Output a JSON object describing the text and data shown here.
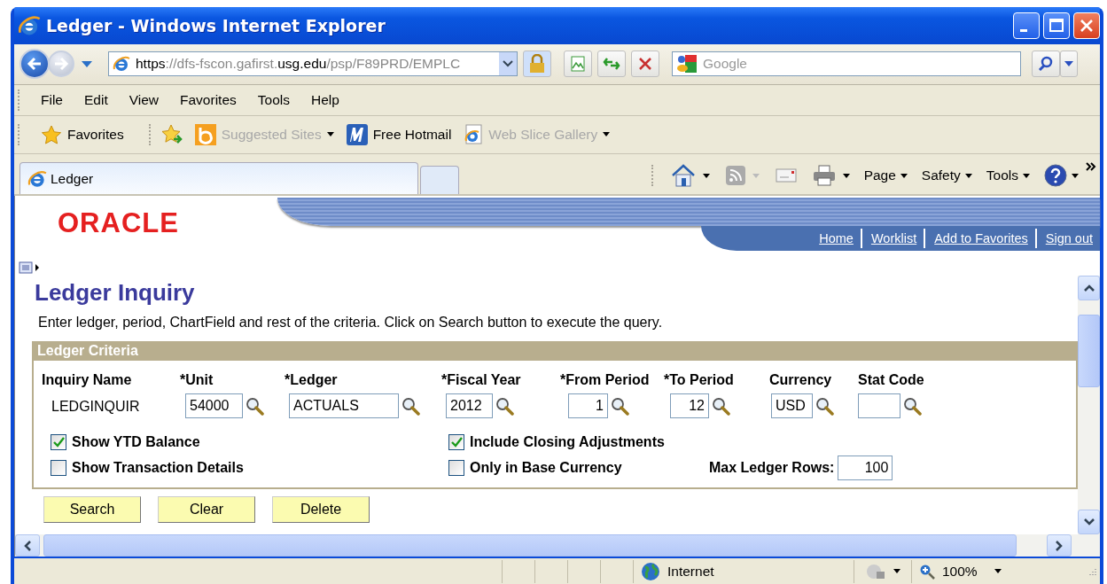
{
  "window": {
    "title": "Ledger - Windows Internet Explorer"
  },
  "address_bar": {
    "url_parts": [
      {
        "text": "https",
        "strong": true
      },
      {
        "text": "://dfs-fscon.gafirst.",
        "strong": false
      },
      {
        "text": "usg.edu",
        "strong": true
      },
      {
        "text": "/psp/F89PRD/EMPLC",
        "strong": false
      }
    ]
  },
  "search": {
    "placeholder": "Google"
  },
  "menu": [
    "File",
    "Edit",
    "View",
    "Favorites",
    "Tools",
    "Help"
  ],
  "favorites_bar": {
    "favorites_button": "Favorites",
    "items": [
      {
        "label": "Suggested Sites",
        "kind": "bing",
        "disabled": true
      },
      {
        "label": "Free Hotmail",
        "kind": "hotmail",
        "disabled": false
      },
      {
        "label": "Web Slice Gallery",
        "kind": "ie",
        "disabled": true
      }
    ]
  },
  "tabs": [
    {
      "label": "Ledger",
      "selected": true
    }
  ],
  "command_bar": {
    "menus": [
      "Page",
      "Safety",
      "Tools"
    ]
  },
  "logo": "ORACLE",
  "header_links": [
    "Home",
    "Worklist",
    "Add to Favorites",
    "Sign out"
  ],
  "page": {
    "title": "Ledger Inquiry",
    "instructions": "Enter ledger, period, ChartField and rest of the criteria. Click on Search button to execute the query."
  },
  "criteria": {
    "title": "Ledger Criteria",
    "fields": [
      {
        "label": "Inquiry Name",
        "kind": "text",
        "value": "LEDGINQUIR"
      },
      {
        "label": "*Unit",
        "kind": "lookup",
        "value": "54000",
        "right_aligned": false
      },
      {
        "label": "*Ledger",
        "kind": "lookup",
        "value": "ACTUALS",
        "right_aligned": false
      },
      {
        "label": "*Fiscal Year",
        "kind": "lookup",
        "value": "2012",
        "right_aligned": false
      },
      {
        "label": "*From Period",
        "kind": "lookup",
        "value": "1",
        "right_aligned": true
      },
      {
        "label": "*To Period",
        "kind": "lookup",
        "value": "12",
        "right_aligned": true
      },
      {
        "label": "Currency",
        "kind": "lookup",
        "value": "USD",
        "right_aligned": false
      },
      {
        "label": "Stat Code",
        "kind": "lookup"
      }
    ],
    "options": [
      {
        "label": "Show YTD Balance",
        "checked": true
      },
      {
        "label": "Include Closing Adjustments",
        "checked": true
      },
      {
        "label": "Show Transaction Details",
        "checked": false
      },
      {
        "label": "Only in Base Currency",
        "checked": false
      }
    ],
    "max_rows": {
      "label": "Max Ledger Rows:",
      "value": "100"
    }
  },
  "buttons": [
    "Search",
    "Clear",
    "Delete"
  ],
  "status_bar": {
    "zone": "Internet",
    "zoom": "100%"
  }
}
